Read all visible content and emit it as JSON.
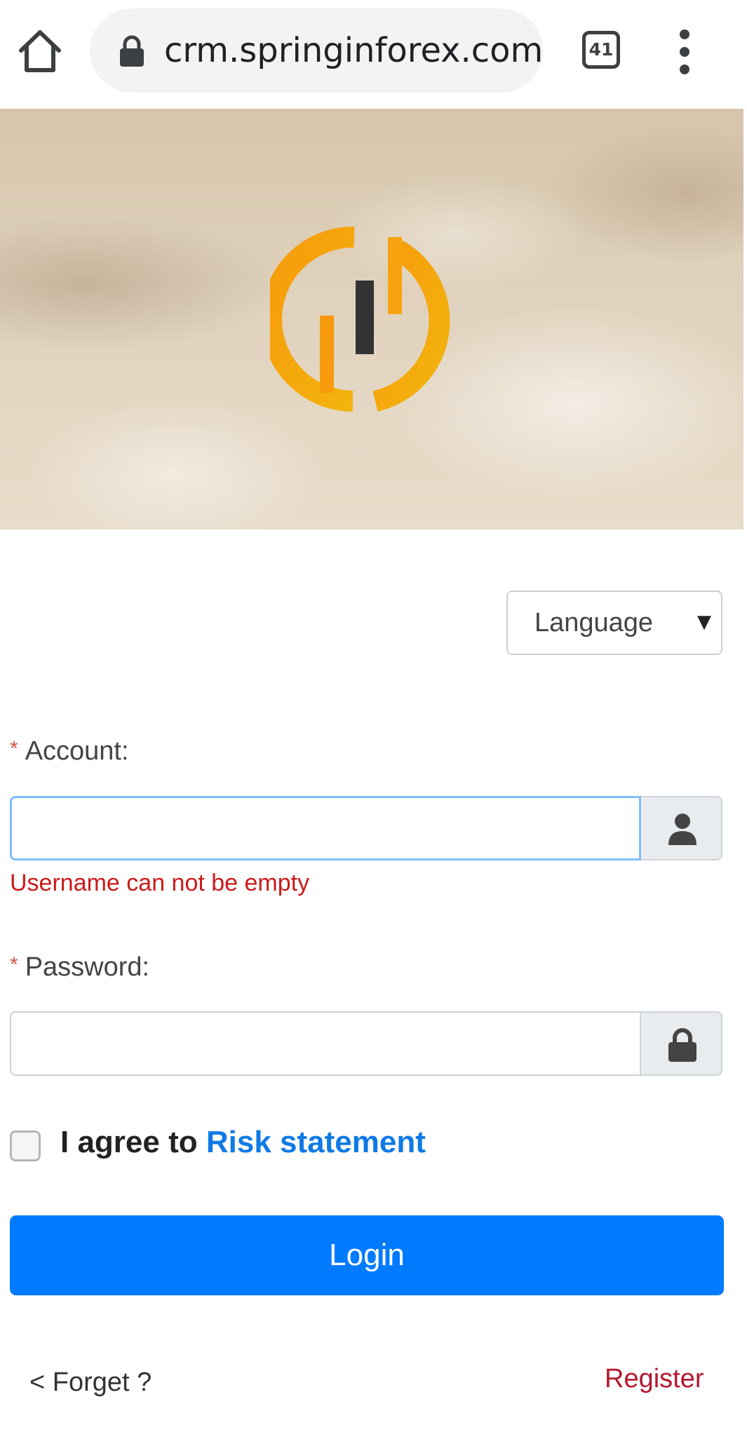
{
  "browser": {
    "url": "crm.springinforex.com",
    "tab_count": "41",
    "icons": {
      "home": "home-icon",
      "lock": "lock-icon",
      "tabs": "tab-switcher-icon",
      "menu": "more-vert-icon"
    }
  },
  "hero": {
    "logo_icon": "power-logo-icon",
    "colors": {
      "logo_orange": "#f7a20f",
      "logo_bar": "#333333"
    }
  },
  "language": {
    "selected": "Language",
    "arrow": "▼"
  },
  "account": {
    "required_mark": "*",
    "label": "Account:",
    "value": "",
    "error": "Username can not be empty",
    "icon": "user-icon"
  },
  "password": {
    "required_mark": "*",
    "label": "Password:",
    "value": "",
    "icon": "lock-icon"
  },
  "agree": {
    "prefix": "I agree to",
    "link": "Risk statement",
    "checked": false
  },
  "login": {
    "label": "Login",
    "color": "#007bff"
  },
  "footer": {
    "forget": "< Forget ?",
    "register": "Register",
    "register_color": "#b3182f"
  }
}
